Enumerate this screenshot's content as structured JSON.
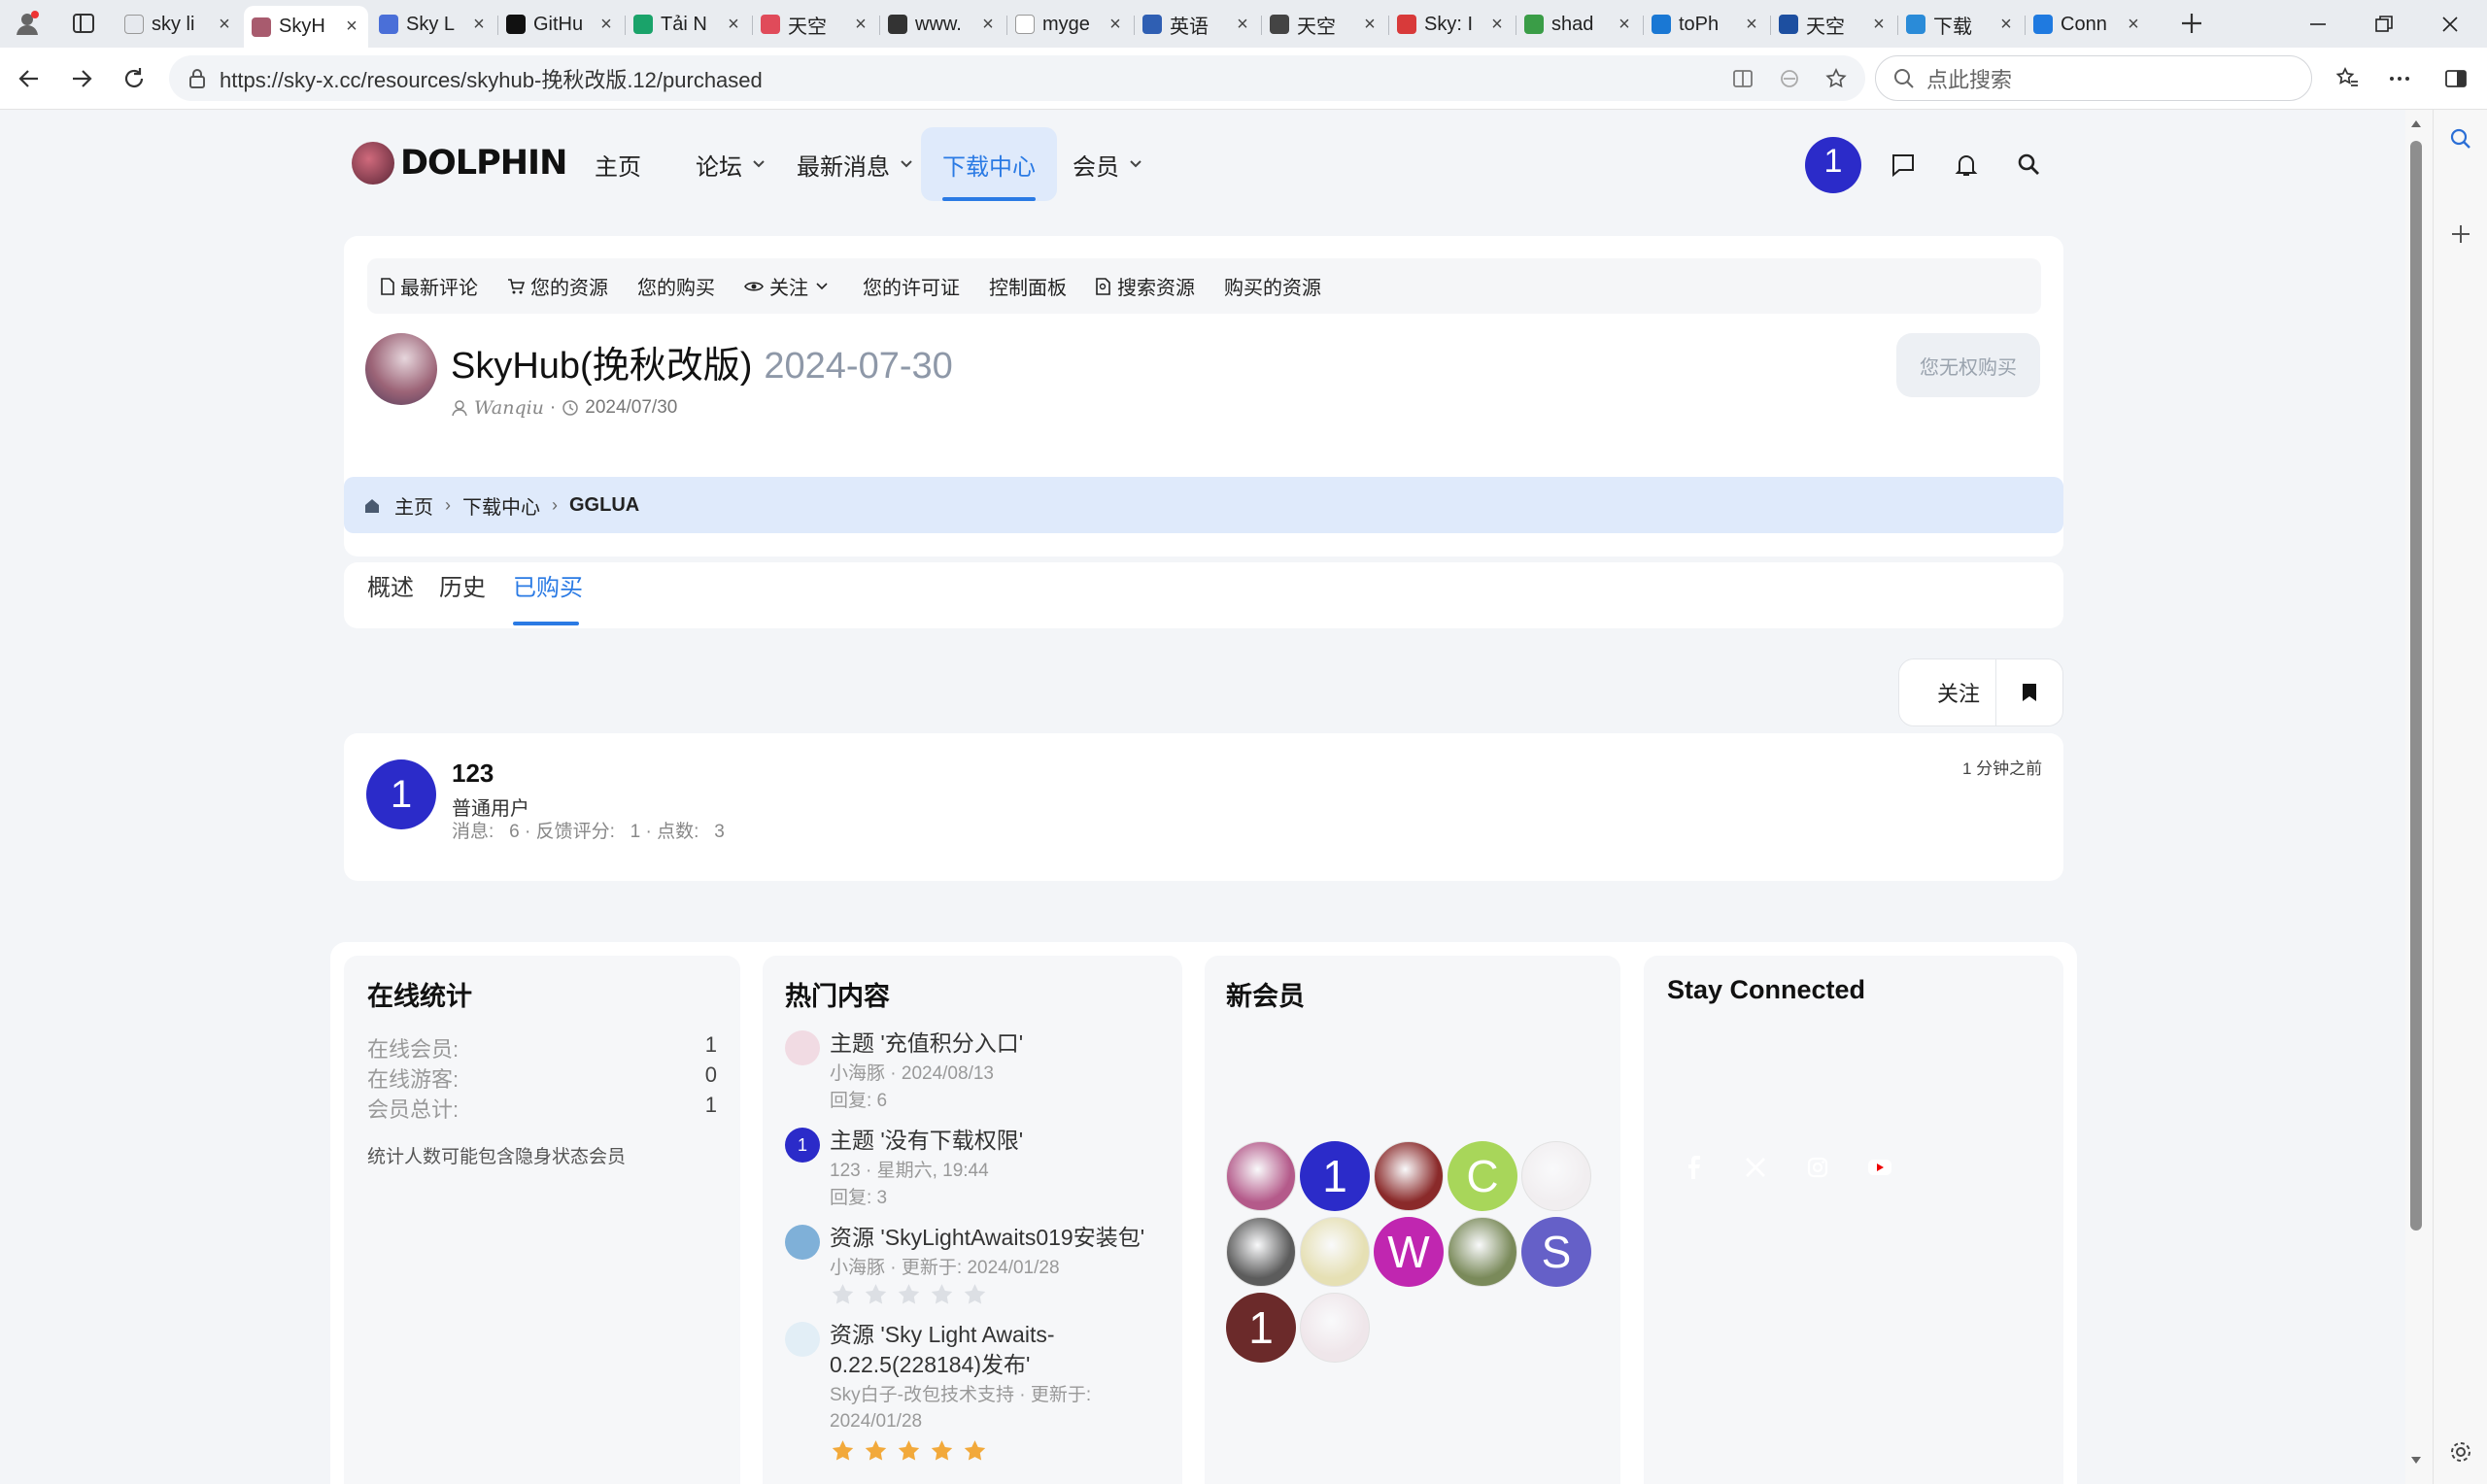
{
  "browser": {
    "tabs": [
      {
        "title": "sky li",
        "favicon_color": "#e6e9ee",
        "favicon_glyph": "search-icon"
      },
      {
        "title": "SkyH",
        "favicon_color": "#a85b6e",
        "favicon_glyph": "dolphin-logo-icon",
        "active": true
      },
      {
        "title": "Sky L",
        "favicon_color": "#4a6fd8",
        "favicon_glyph": "123"
      },
      {
        "title": "GitHu",
        "favicon_color": "#111111",
        "favicon_glyph": "github-icon"
      },
      {
        "title": "Tải N",
        "favicon_color": "#1aa36a",
        "favicon_glyph": "refresh-icon"
      },
      {
        "title": "天空",
        "favicon_color": "#e04b5a",
        "favicon_glyph": "bird-icon"
      },
      {
        "title": "www.",
        "favicon_color": "#333333",
        "favicon_glyph": "document-icon"
      },
      {
        "title": "myge",
        "favicon_color": "#ffffff",
        "favicon_glyph": "page-icon"
      },
      {
        "title": "英语",
        "favicon_color": "#2f5fb3",
        "favicon_glyph": "flag-icon"
      },
      {
        "title": "天空",
        "favicon_color": "#444444",
        "favicon_glyph": "g"
      },
      {
        "title": "Sky: I",
        "favicon_color": "#d83a3a",
        "favicon_glyph": "apple-icon"
      },
      {
        "title": "shad",
        "favicon_color": "#3a9d47",
        "favicon_glyph": "dots-icon"
      },
      {
        "title": "toPh",
        "favicon_color": "#1a78d4",
        "favicon_glyph": "tophub-icon"
      },
      {
        "title": "天空",
        "favicon_color": "#1d4fa0",
        "favicon_glyph": "globe-icon"
      },
      {
        "title": "下载",
        "favicon_color": "#2a8bd8",
        "favicon_glyph": "q-icon"
      },
      {
        "title": "Conn",
        "favicon_color": "#1f7ae0",
        "favicon_glyph": "appstore-icon"
      }
    ],
    "url": "https://sky-x.cc/resources/skyhub-挽秋改版.12/purchased",
    "search_placeholder": "点此搜索"
  },
  "site": {
    "logo_text": "DOLPHIN",
    "nav": [
      {
        "label": "主页",
        "has_menu": false
      },
      {
        "label": "论坛",
        "has_menu": true
      },
      {
        "label": "最新消息",
        "has_menu": true
      },
      {
        "label": "下载中心",
        "has_menu": false,
        "active": true
      },
      {
        "label": "会员",
        "has_menu": true
      }
    ],
    "user_avatar_letter": "1"
  },
  "subnav": [
    {
      "label": "最新评论",
      "icon": "document-icon"
    },
    {
      "label": "您的资源",
      "icon": "cart-icon"
    },
    {
      "label": "您的购买",
      "icon": ""
    },
    {
      "label": "关注",
      "icon": "eye-icon",
      "has_menu": true
    },
    {
      "label": "您的许可证",
      "icon": ""
    },
    {
      "label": "控制面板",
      "icon": ""
    },
    {
      "label": "搜索资源",
      "icon": "search-doc-icon"
    },
    {
      "label": "购买的资源",
      "icon": ""
    }
  ],
  "resource": {
    "title": "SkyHub(挽秋改版)",
    "version": "2024-07-30",
    "author": "Wanqiu",
    "date": "2024/07/30",
    "buy_label": "您无权购买"
  },
  "breadcrumb": [
    "主页",
    "下载中心",
    "GGLUA"
  ],
  "tabs": [
    {
      "label": "概述"
    },
    {
      "label": "历史"
    },
    {
      "label": "已购买",
      "active": true
    }
  ],
  "follow_label": "关注",
  "buyer": {
    "avatar_letter": "1",
    "name": "123",
    "role": "普通用户",
    "stats": "消息:   6 · 反馈评分:   1 · 点数:   3",
    "time": "1 分钟之前"
  },
  "online": {
    "title": "在线统计",
    "rows": [
      {
        "label": "在线会员:",
        "value": "1"
      },
      {
        "label": "在线游客:",
        "value": "0"
      },
      {
        "label": "会员总计:",
        "value": "1"
      }
    ],
    "note": "统计人数可能包含隐身状态会员"
  },
  "hot": {
    "title": "热门内容",
    "items": [
      {
        "title": "主题 '充值积分入口'",
        "meta": "小海豚 · 2024/08/13",
        "extra": "回复:   6",
        "icon_color": "#f1dbe3"
      },
      {
        "title": "主题 '没有下载权限'",
        "meta": "123 · 星期六, 19:44",
        "extra": "回复:   3",
        "icon_color": "#2b2bc9",
        "icon_letter": "1"
      },
      {
        "title": "资源 'SkyLightAwaits019安装包'",
        "meta": "小海豚 · 更新于:   2024/01/28",
        "rating": 0,
        "icon_color": "#7fb0d8"
      },
      {
        "title": "资源 'Sky Light Awaits-0.22.5(228184)发布'",
        "meta": "Sky白子-改包技术支持 · 更新于:   2024/01/28",
        "rating": 5,
        "icon_color": "#e2eef6"
      }
    ]
  },
  "new_members": {
    "title": "新会员",
    "members": [
      {
        "kind": "img",
        "color": "#b45a8a"
      },
      {
        "kind": "letter",
        "letter": "1",
        "color": "#2b2bc9"
      },
      {
        "kind": "img",
        "color": "#8a2a2a"
      },
      {
        "kind": "letter",
        "letter": "C",
        "color": "#a8d65a"
      },
      {
        "kind": "img",
        "color": "#f1eef0"
      },
      {
        "kind": "img",
        "color": "#5c5c5c"
      },
      {
        "kind": "img",
        "color": "#e6e0b4"
      },
      {
        "kind": "letter",
        "letter": "W",
        "color": "#c026b0"
      },
      {
        "kind": "img",
        "color": "#7a8a5a"
      },
      {
        "kind": "letter",
        "letter": "S",
        "color": "#6560c8"
      },
      {
        "kind": "letter",
        "letter": "1",
        "color": "#6b2a2a"
      },
      {
        "kind": "img",
        "color": "#efe6ea"
      }
    ]
  },
  "social": {
    "title": "Stay Connected",
    "links": [
      {
        "name": "facebook",
        "color": "#1a3d85"
      },
      {
        "name": "x",
        "color": "#111111"
      },
      {
        "name": "instagram",
        "color": "#d62f6d"
      },
      {
        "name": "youtube",
        "color": "#ee0000"
      }
    ]
  }
}
